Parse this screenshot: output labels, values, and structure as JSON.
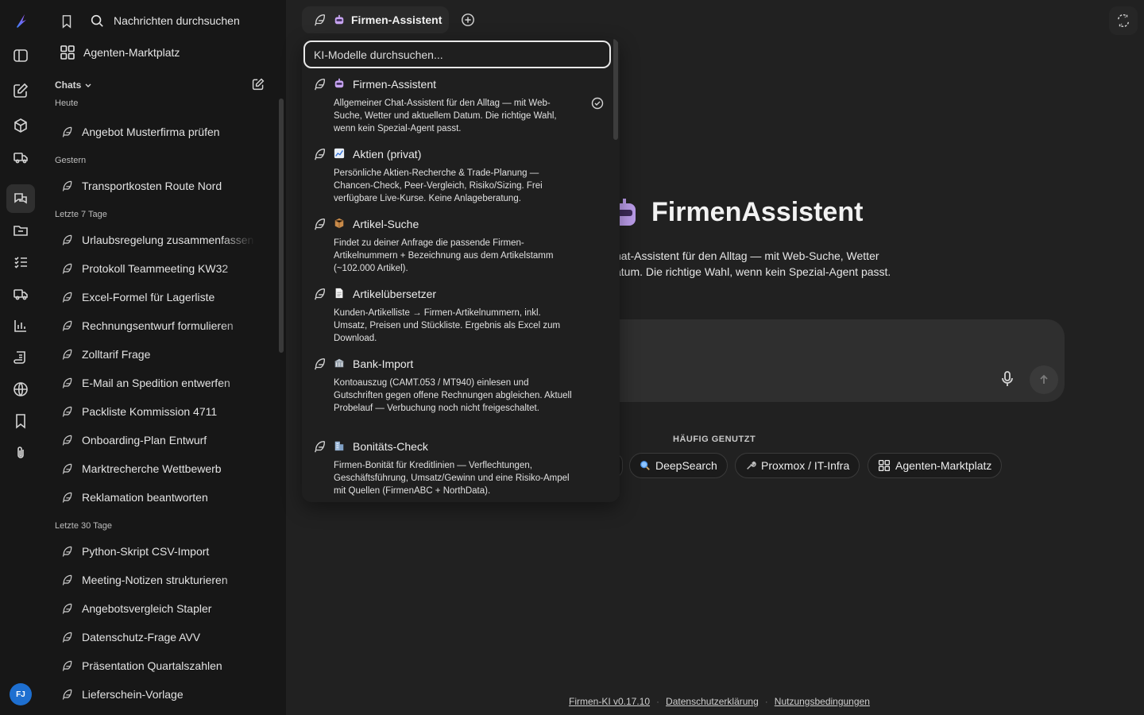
{
  "rail": {
    "avatar_initials": "FJ"
  },
  "sidebar": {
    "search_label": "Nachrichten durchsuchen",
    "marketplace_label": "Agenten-Marktplatz",
    "chats_label": "Chats",
    "groups": [
      {
        "label": "Heute",
        "items": [
          "Angebot Musterfirma prüfen"
        ]
      },
      {
        "label": "Gestern",
        "items": [
          "Transportkosten Route Nord"
        ]
      },
      {
        "label": "Letzte 7 Tage",
        "items": [
          "Urlaubsregelung zusammenfassen",
          "Protokoll Teammeeting KW32",
          "Excel-Formel für Lagerliste",
          "Rechnungsentwurf formulieren",
          "Zolltarif Frage",
          "E-Mail an Spedition entwerfen",
          "Packliste Kommission 4711",
          "Onboarding-Plan Entwurf",
          "Marktrecherche Wettbewerb",
          "Reklamation beantworten"
        ]
      },
      {
        "label": "Letzte 30 Tage",
        "items": [
          "Python-Skript CSV-Import",
          "Meeting-Notizen strukturieren",
          "Angebotsvergleich Stapler",
          "Datenschutz-Frage AVV",
          "Präsentation Quartalszahlen",
          "Lieferschein-Vorlage"
        ]
      }
    ]
  },
  "header": {
    "model_tab_label": "Firmen-Assistent"
  },
  "dropdown": {
    "search_placeholder": "KI-Modelle durchsuchen...",
    "models": [
      {
        "name": "Firmen-Assistent",
        "icon": "robot-icon",
        "desc": "Allgemeiner Chat-Assistent für den Alltag — mit Web-Suche, Wetter und aktuellem Datum. Die richtige Wahl, wenn kein Spezial-Agent passt.",
        "selected": true
      },
      {
        "name": "Aktien (privat)",
        "icon": "chart-icon",
        "desc": "Persönliche Aktien-Recherche & Trade-Planung — Chancen-Check, Peer-Vergleich, Risiko/Sizing. Frei verfügbare Live-Kurse. Keine Anlageberatung.",
        "selected": false
      },
      {
        "name": "Artikel-Suche",
        "icon": "package-icon",
        "desc": "Findet zu deiner Anfrage die passende Firmen-Artikelnummern + Bezeichnung aus dem Artikelstamm (~102.000 Artikel).",
        "selected": false
      },
      {
        "name": "Artikelübersetzer",
        "icon": "document-icon",
        "desc": "Kunden-Artikelliste → Firmen-Artikelnummern, inkl. Umsatz, Preisen und Stückliste. Ergebnis als Excel zum Download.",
        "selected": false
      },
      {
        "name": "Bank-Import",
        "icon": "bank-icon",
        "desc": "Kontoauszug (CAMT.053 / MT940) einlesen und Gutschriften gegen offene Rechnungen abgleichen. Aktuell Probelauf — Verbuchung noch nicht freigeschaltet.",
        "selected": false
      },
      {
        "name": "Bonitäts-Check",
        "icon": "office-building-icon",
        "desc": "Firmen-Bonität für Kreditlinien — Verflechtungen, Geschäftsführung, Umsatz/Gewinn und eine Risiko-Ampel mit Quellen (FirmenABC + NorthData).",
        "selected": false
      }
    ]
  },
  "hero": {
    "title": "FirmenAssistent",
    "desc_line1": "hat-Assistent für den Alltag — mit Web-Suche, Wetter",
    "desc_line2": "atum. Die richtige Wahl, wenn kein Spezial-Agent passt."
  },
  "frequent": {
    "label": "HÄUFIG GENUTZT",
    "chips": [
      {
        "label": "DeepSearch",
        "icon": "magnifier-icon"
      },
      {
        "label": "Proxmox / IT-Infra",
        "icon": "wrench-icon"
      },
      {
        "label": "Agenten-Marktplatz",
        "icon": "grid-icon"
      }
    ]
  },
  "footer": {
    "version": "Firmen-KI v0.17.10",
    "privacy": "Datenschutzerklärung",
    "terms": "Nutzungsbedingungen"
  },
  "colors": {
    "background": "#212121",
    "sidebar": "#171717",
    "accent_avatar": "#1e6fd0"
  }
}
